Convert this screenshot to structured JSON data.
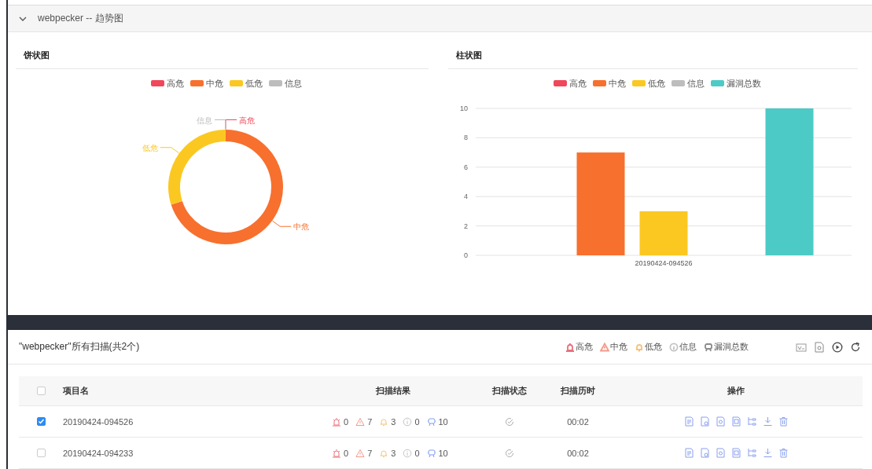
{
  "header": {
    "title": "webpecker -- 趋势图",
    "expanded": true
  },
  "pie_card": {
    "title": "饼状图",
    "legend": [
      {
        "label": "高危",
        "color": "#f0475a"
      },
      {
        "label": "中危",
        "color": "#f7702e"
      },
      {
        "label": "低危",
        "color": "#fbc822"
      },
      {
        "label": "信息",
        "color": "#bdbdbd"
      }
    ],
    "chart_data": {
      "type": "donut",
      "categories": [
        "高危",
        "中危",
        "低危",
        "信息"
      ],
      "values": [
        0,
        70,
        30,
        0
      ]
    }
  },
  "bar_card": {
    "title": "柱状图",
    "chart_data": {
      "type": "bar",
      "grid": true,
      "categories": [
        "20190424-094526"
      ],
      "ylim": [
        0,
        10
      ],
      "yticks": [
        0,
        2,
        4,
        6,
        8,
        10
      ],
      "series": [
        {
          "name": "高危",
          "color": "#f0475a",
          "values": [
            0
          ]
        },
        {
          "name": "中危",
          "color": "#f7702e",
          "values": [
            7
          ]
        },
        {
          "name": "低危",
          "color": "#fbc822",
          "values": [
            3
          ]
        },
        {
          "name": "信息",
          "color": "#bdbdbd",
          "values": [
            0
          ]
        },
        {
          "name": "漏洞总数",
          "color": "#4ccac6",
          "values": [
            10
          ]
        }
      ]
    }
  },
  "scans": {
    "title": "\"webpecker\"所有扫描(共2个)",
    "legend": [
      {
        "label": "高危",
        "color": "#e8707a"
      },
      {
        "label": "中危",
        "color": "#f39a8a"
      },
      {
        "label": "低危",
        "color": "#f6c37a"
      },
      {
        "label": "信息",
        "color": "#c4c4c4"
      },
      {
        "label": "漏洞总数",
        "color": "#8a8a8a"
      }
    ],
    "table": {
      "all_selected": false,
      "columns": [
        "项目名",
        "扫描结果",
        "扫描状态",
        "扫描历时",
        "操作"
      ],
      "rows": [
        {
          "selected": true,
          "name": "20190424-094526",
          "results": [
            "0",
            "7",
            "3",
            "0",
            "10"
          ],
          "duration": "00:02"
        },
        {
          "selected": false,
          "name": "20190424-094233",
          "results": [
            "0",
            "7",
            "3",
            "0",
            "10"
          ],
          "duration": "00:02"
        }
      ]
    }
  }
}
